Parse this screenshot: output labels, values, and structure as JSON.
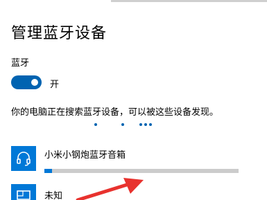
{
  "header": {
    "title": "管理蓝牙设备"
  },
  "bluetooth": {
    "label": "蓝牙",
    "toggle_state": "开",
    "toggle_on": true,
    "status": "你的电脑正在搜索蓝牙设备，可以被这些设备发现。"
  },
  "devices": [
    {
      "name": "小米小钢炮蓝牙音箱",
      "icon": "headset-icon",
      "progress": 0.04
    },
    {
      "name": "未知",
      "icon": "monitor-icon"
    }
  ],
  "annotation": {
    "icon": "red-arrow-annotation"
  },
  "colors": {
    "accent": "#0063b1",
    "tile": "#0078d7",
    "track": "#cccccc",
    "arrow": "#e8322e"
  }
}
